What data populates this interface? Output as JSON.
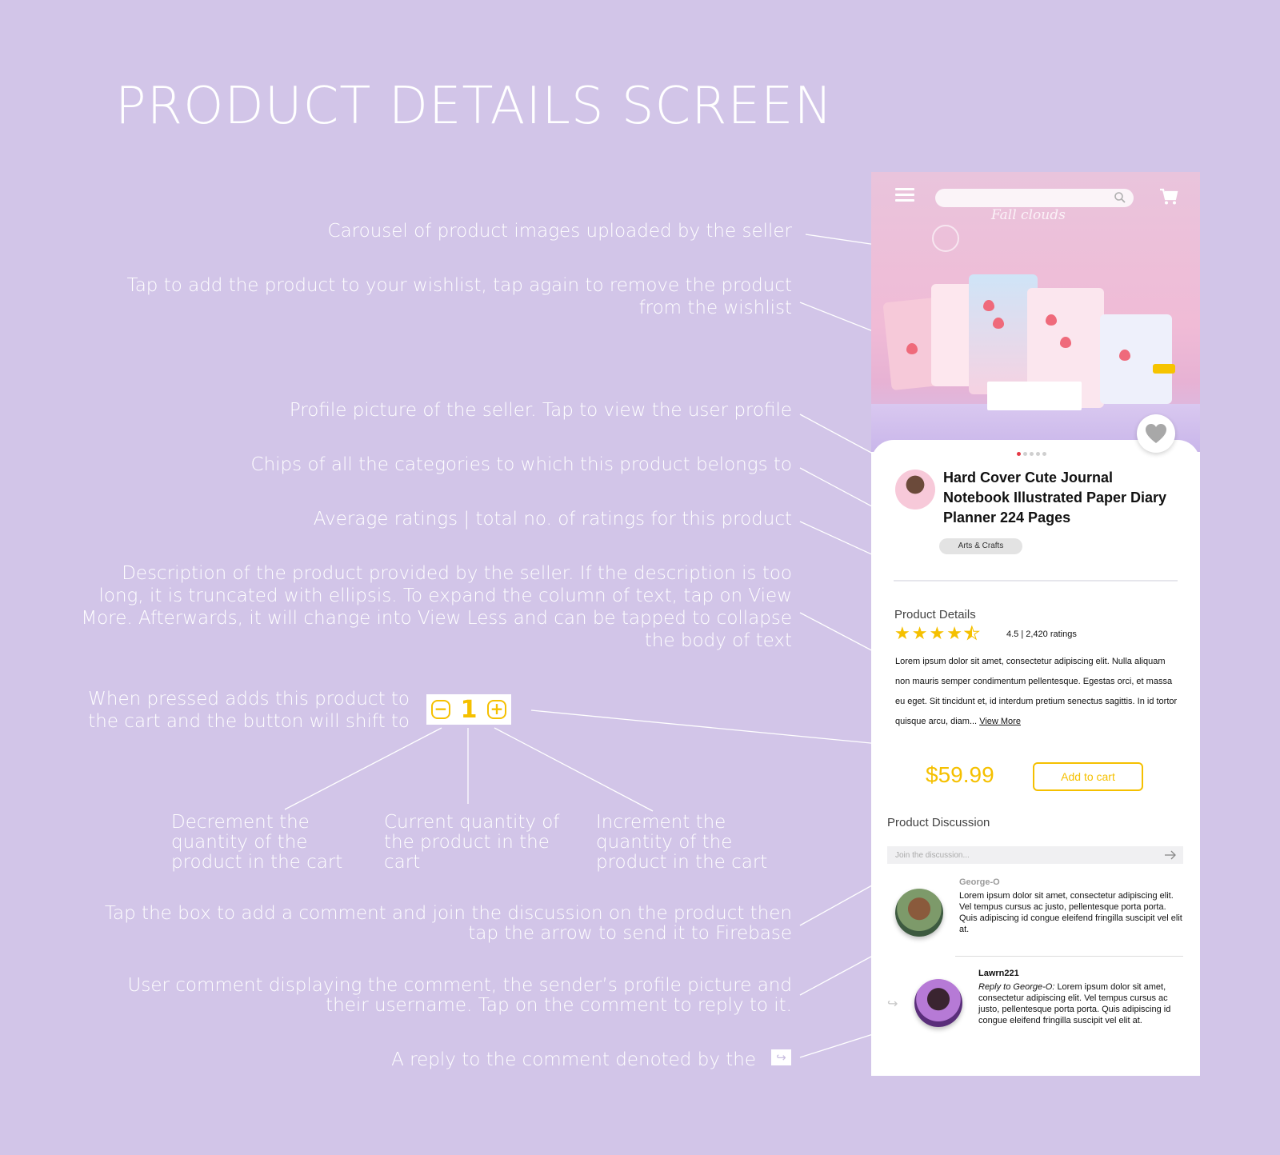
{
  "page": {
    "title": "PRODUCT DETAILS SCREEN"
  },
  "annotations": {
    "carousel": "Carousel of product images uploaded by the seller",
    "wishlist": "Tap to add the product to your wishlist, tap again to remove the product from the wishlist",
    "profile": "Profile picture of the seller. Tap to view the user profile",
    "chips": "Chips of all the categories to which this product belongs to",
    "ratings": "Average ratings | total no. of ratings for this product",
    "description": "Description of the product provided by the seller. If the description is too long, it is truncated with ellipsis. To expand the column of text, tap on View More. Afterwards, it will change into View Less and can be tapped to collapse the body of text",
    "add_to_cart": "When pressed adds this product to the cart and the button will shift to",
    "decrement": "Decrement the quantity of the product in the cart",
    "current_qty": "Current quantity of the product in the cart",
    "increment": "Increment the quantity of the product in the cart",
    "discussion_box": "Tap the box to add a comment and join the discussion on the product then tap the arrow to send it to Firebase",
    "user_comment": "User comment displaying the comment, the sender’s profile picture and their username. Tap on the comment to reply to it.",
    "reply": "A reply to the comment denoted by the"
  },
  "stepper_sample": {
    "minus": "−",
    "quantity": "1",
    "plus": "+"
  },
  "reply_icon_glyph": "↪",
  "phone": {
    "hero_text": "Fall clouds",
    "search_placeholder": "",
    "carousel": {
      "count": 5,
      "active_index": 0
    },
    "product": {
      "title": "Hard Cover Cute Journal Notebook Illustrated Paper Diary Planner 224 Pages",
      "category_chip": "Arts & Crafts",
      "section_label": "Product Details",
      "rating_value": 4.5,
      "rating_text": "4.5 | 2,420 ratings",
      "description": "Lorem ipsum dolor sit amet, consectetur adipiscing elit. Nulla aliquam non mauris semper condimentum pellentesque. Egestas orci, et massa eu eget. Sit tincidunt et, id interdum pretium senectus sagittis. In id tortor quisque arcu, diam...",
      "view_more": "View More",
      "price": "$59.99",
      "add_to_cart": "Add to cart"
    },
    "discussion": {
      "label": "Product Discussion",
      "input_placeholder": "Join the discussion...",
      "comments": [
        {
          "username": "George-O",
          "text": "Lorem ipsum dolor sit amet, consectetur adipiscing elit. Vel tempus cursus ac justo, pellentesque porta porta. Quis adipiscing id congue eleifend fringilla suscipit vel elit at."
        },
        {
          "username": "Lawrn221",
          "reply_to": "Reply to George-O:",
          "text": "Lorem ipsum dolor sit amet, consectetur adipiscing elit. Vel tempus cursus ac justo, pellentesque porta porta. Quis adipiscing id congue eleifend fringilla suscipit vel elit at."
        }
      ]
    }
  },
  "colors": {
    "background": "#d2c5e8",
    "accent_yellow": "#f5c000",
    "active_dot": "#e53945"
  }
}
